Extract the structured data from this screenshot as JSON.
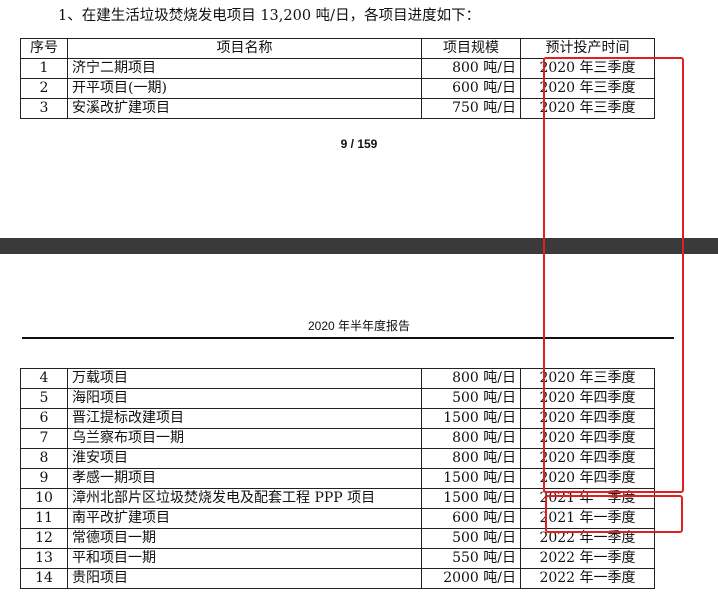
{
  "intro": "1、在建生活垃圾焚烧发电项目 13,200 吨/日，各项目进度如下：",
  "headers": {
    "no": "序号",
    "name": "项目名称",
    "scale": "项目规模",
    "time": "预计投产时间"
  },
  "rows_page1": [
    {
      "no": "1",
      "name": "济宁二期项目",
      "scale": "800 吨/日",
      "time": "2020 年三季度"
    },
    {
      "no": "2",
      "name": "开平项目(一期)",
      "scale": "600 吨/日",
      "time": "2020 年三季度"
    },
    {
      "no": "3",
      "name": "安溪改扩建项目",
      "scale": "750 吨/日",
      "time": "2020 年三季度"
    }
  ],
  "page_number": "9 / 159",
  "running_header": "2020 年半年度报告",
  "rows_page2": [
    {
      "no": "4",
      "name": "万载项目",
      "scale": "800 吨/日",
      "time": "2020 年三季度"
    },
    {
      "no": "5",
      "name": "海阳项目",
      "scale": "500 吨/日",
      "time": "2020 年四季度"
    },
    {
      "no": "6",
      "name": "晋江提标改建项目",
      "scale": "1500 吨/日",
      "time": "2020 年四季度"
    },
    {
      "no": "7",
      "name": "乌兰察布项目一期",
      "scale": "800 吨/日",
      "time": "2020 年四季度"
    },
    {
      "no": "8",
      "name": "淮安项目",
      "scale": "800 吨/日",
      "time": "2020 年四季度"
    },
    {
      "no": "9",
      "name": "孝感一期项目",
      "scale": "1500 吨/日",
      "time": "2020 年四季度"
    },
    {
      "no": "10",
      "name": "漳州北部片区垃圾焚烧发电及配套工程 PPP 项目",
      "scale": "1500 吨/日",
      "time": "2021 年一季度"
    },
    {
      "no": "11",
      "name": "南平改扩建项目",
      "scale": "600 吨/日",
      "time": "2021 年一季度"
    },
    {
      "no": "12",
      "name": "常德项目一期",
      "scale": "500 吨/日",
      "time": "2022 年一季度"
    },
    {
      "no": "13",
      "name": "平和项目一期",
      "scale": "550 吨/日",
      "time": "2022 年一季度"
    },
    {
      "no": "14",
      "name": "贵阳项目",
      "scale": "2000 吨/日",
      "time": "2022 年一季度"
    }
  ],
  "highlight_color": "#e02020"
}
